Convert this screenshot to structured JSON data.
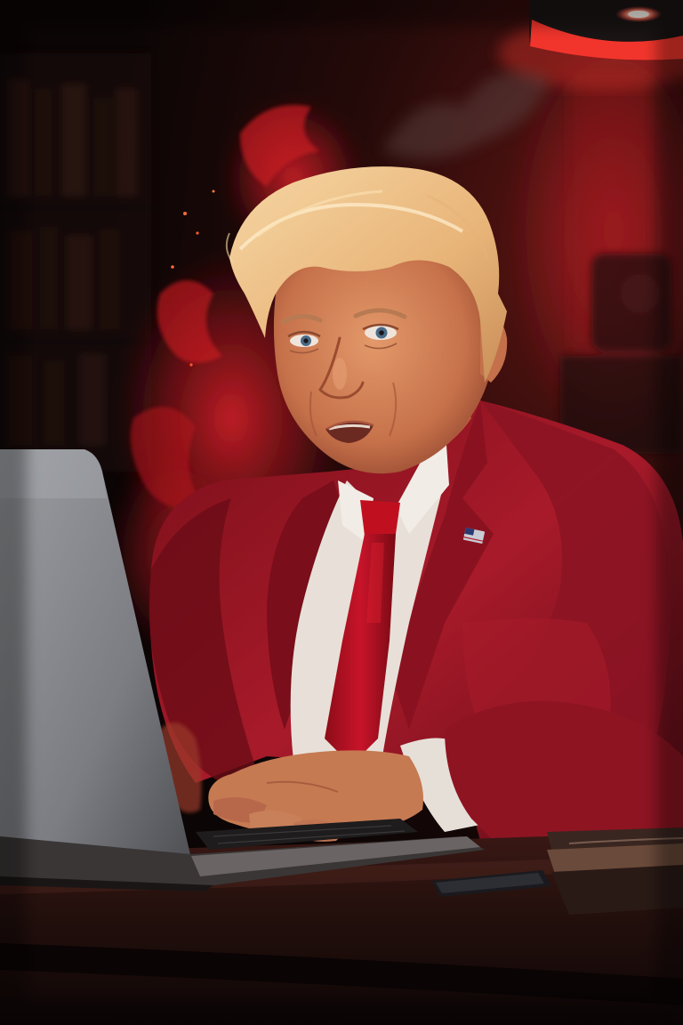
{
  "image": {
    "kind": "photograph",
    "subject": "man-in-red-suit-typing-on-laptop",
    "elements": [
      "red-smoke",
      "hanging-lamp",
      "laptop",
      "desk",
      "bookshelf",
      "flag-lapel-pin",
      "books-on-desk",
      "smartphone"
    ]
  },
  "palette": {
    "background": "#130808",
    "suit": "#9e1626",
    "suit_shadow": "#4a0a12",
    "tie": "#b0101e",
    "shirt": "#e8e2dc",
    "skin": "#d98a5c",
    "hair": "#f0c894",
    "smoke": "#d11a22",
    "lamp_glow": "#ff3a32",
    "laptop": "#8d8f94",
    "desk": "#2a1210"
  }
}
